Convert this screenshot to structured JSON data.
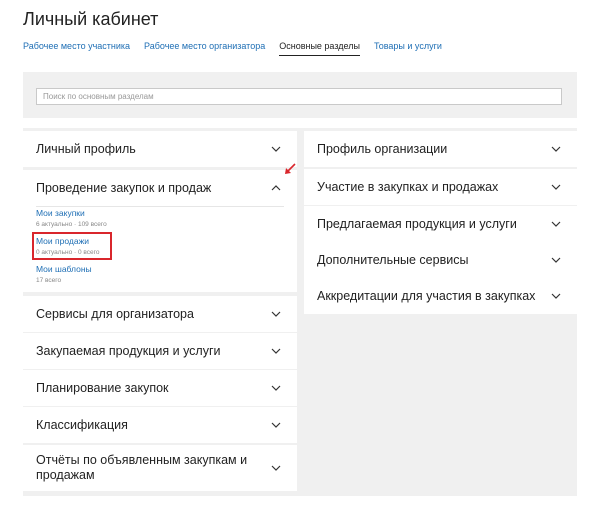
{
  "page": {
    "title": "Личный кабинет"
  },
  "tabs": [
    {
      "label": "Рабочее место участника",
      "active": false
    },
    {
      "label": "Рабочее место организатора",
      "active": false
    },
    {
      "label": "Основные разделы",
      "active": true
    },
    {
      "label": "Товары и услуги",
      "active": false
    }
  ],
  "search": {
    "placeholder": "Поиск по основным разделам",
    "value": ""
  },
  "left_sections": [
    {
      "title": "Личный профиль",
      "expanded": false
    },
    {
      "title": "Проведение закупок и продаж",
      "expanded": true,
      "items": [
        {
          "label": "Мои закупки",
          "meta": "6 актуально · 109 всего"
        },
        {
          "label": "Мои продажи",
          "meta": "0 актуально · 0 всего",
          "highlighted": true
        },
        {
          "label": "Мои шаблоны",
          "meta": "17 всего"
        }
      ]
    },
    {
      "title": "Сервисы для организатора",
      "expanded": false
    },
    {
      "title": "Закупаемая продукция и услуги",
      "expanded": false
    },
    {
      "title": "Планирование закупок",
      "expanded": false
    },
    {
      "title": "Классификация",
      "expanded": false
    },
    {
      "title": "Отчёты по объявленным закупкам и продажам",
      "expanded": false
    }
  ],
  "right_sections": [
    {
      "title": "Профиль организации",
      "expanded": false
    },
    {
      "title": "Участие в закупках и продажах",
      "expanded": false
    },
    {
      "title": "Предлагаемая продукция и услуги",
      "expanded": false
    },
    {
      "title": "Дополнительные сервисы",
      "expanded": false
    },
    {
      "title": "Аккредитации для участия в закупках",
      "expanded": false
    }
  ],
  "colors": {
    "link": "#1f6fb5",
    "highlight": "#d9262c",
    "panel_bg": "#f0f0f0"
  }
}
